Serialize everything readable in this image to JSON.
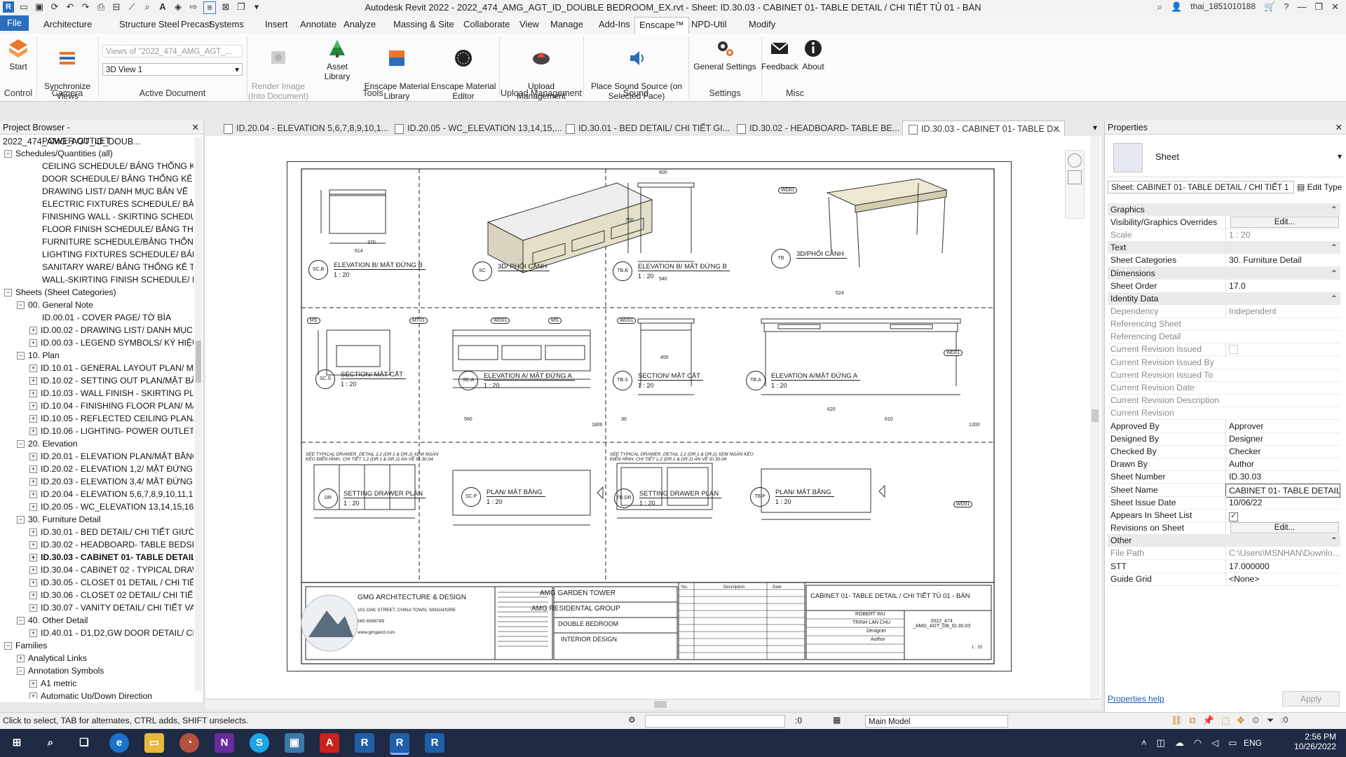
{
  "titlebar": {
    "title": "Autodesk Revit 2022 - 2022_474_AMG_AGT_ID_DOUBLE BEDROOM_EX.rvt - Sheet: ID.30.03 - CABINET 01- TABLE DETAIL / CHI TIẾT TỦ 01 - BÀN",
    "user": "thai_1851010188"
  },
  "menu": {
    "file": "File",
    "tabs": [
      "Architecture",
      "Structure",
      "Steel",
      "Precast",
      "Systems",
      "Insert",
      "Annotate",
      "Analyze",
      "Massing & Site",
      "Collaborate",
      "View",
      "Manage",
      "Add-Ins",
      "Enscape™",
      "NPD-Util",
      "Modify"
    ],
    "active": "Enscape™"
  },
  "ribbon": {
    "start": "Start",
    "sync": "Synchronize\nViews",
    "views_placeholder": "Views of \"2022_474_AMG_AGT_...",
    "view_combo": "3D View 1",
    "render": "Render Image\n(Into Document)",
    "asset": "Asset Library",
    "material_lib": "Enscape Material\nLibrary",
    "material_editor": "Enscape Material\nEditor",
    "upload": "Upload\nManagement",
    "sound": "Place Sound Source (on\nSelected Face)",
    "general": "General Settings",
    "feedback": "Feedback",
    "about": "About",
    "groups": [
      "Control",
      "Camera",
      "Active Document",
      "Tools",
      "Upload Management",
      "Sound",
      "Settings",
      "Misc"
    ]
  },
  "project_browser": {
    "title": "Project Browser - 2022_474_AMG_AGT_ID_DOUB...",
    "rows": [
      {
        "text": "POWER OUTLET",
        "indent": 3,
        "tog": ""
      },
      {
        "text": "Schedules/Quantities (all)",
        "indent": 0,
        "tog": "−"
      },
      {
        "text": "CEILING SCHEDULE/ BẢNG THỐNG KÊ TRẦ",
        "indent": 3,
        "tog": ""
      },
      {
        "text": "DOOR SCHEDULE/ BẢNG THỐNG KÊ CỬA",
        "indent": 3,
        "tog": ""
      },
      {
        "text": "DRAWING LIST/ DANH MỤC BẢN VẼ",
        "indent": 3,
        "tog": ""
      },
      {
        "text": "ELECTRIC FIXTURES SCHEDULE/ BẢNG THỐ",
        "indent": 3,
        "tog": ""
      },
      {
        "text": "FINISHING WALL - SKIRTING SCHEDULE",
        "indent": 3,
        "tog": ""
      },
      {
        "text": "FLOOR FINISH SCHEDULE/ BẢNG THỐNG K",
        "indent": 3,
        "tog": ""
      },
      {
        "text": "FURNITURE SCHEDULE/BẢNG THỐNG KÊ Đ",
        "indent": 3,
        "tog": ""
      },
      {
        "text": "LIGHTING FIXTURES SCHEDULE/ BẢNG THỐ",
        "indent": 3,
        "tog": ""
      },
      {
        "text": "SANITARY WARE/ BẢNG THỐNG KÊ TBVS",
        "indent": 3,
        "tog": ""
      },
      {
        "text": "WALL-SKIRTING FINISH SCHEDULE/ BẢNG T",
        "indent": 3,
        "tog": ""
      },
      {
        "text": "Sheets (Sheet Categories)",
        "indent": 0,
        "tog": "−"
      },
      {
        "text": "00. General Note",
        "indent": 1,
        "tog": "−"
      },
      {
        "text": "ID.00.01 - COVER PAGE/ TỜ BÌA",
        "indent": 3,
        "tog": ""
      },
      {
        "text": "ID.00.02 - DRAWING LIST/ DANH MỤC",
        "indent": 2,
        "tog": "+"
      },
      {
        "text": "ID.00.03 - LEGEND SYMBOLS/ KÝ HIỆU",
        "indent": 2,
        "tog": "+"
      },
      {
        "text": "10. Plan",
        "indent": 1,
        "tog": "−"
      },
      {
        "text": "ID.10.01 - GENERAL LAYOUT PLAN/ MẶ",
        "indent": 2,
        "tog": "+"
      },
      {
        "text": "ID.10.02 - SETTING OUT PLAN/MẶT BẰ",
        "indent": 2,
        "tog": "+"
      },
      {
        "text": "ID.10.03 - WALL FINISH - SKIRTING PLA",
        "indent": 2,
        "tog": "+"
      },
      {
        "text": "ID.10.04 - FINISHING FLOOR PLAN/ MẶ",
        "indent": 2,
        "tog": "+"
      },
      {
        "text": "ID.10.05 - REFLECTED CEILING PLAN/ M",
        "indent": 2,
        "tog": "+"
      },
      {
        "text": "ID.10.06 - LIGHTING- POWER OUTLET F",
        "indent": 2,
        "tog": "+"
      },
      {
        "text": "20. Elevation",
        "indent": 1,
        "tog": "−"
      },
      {
        "text": "ID.20.01 - ELEVATION PLAN/MẶT BẰNG",
        "indent": 2,
        "tog": "+"
      },
      {
        "text": "ID.20.02 - ELEVATION 1,2/ MẶT ĐỨNG",
        "indent": 2,
        "tog": "+"
      },
      {
        "text": "ID.20.03 - ELEVATION 3,4/ MẶT ĐỨNG",
        "indent": 2,
        "tog": "+"
      },
      {
        "text": "ID.20.04 - ELEVATION 5,6,7,8,9,10,11,1",
        "indent": 2,
        "tog": "+"
      },
      {
        "text": "ID.20.05 - WC_ELEVATION 13,14,15,16,",
        "indent": 2,
        "tog": "+"
      },
      {
        "text": "30. Furniture Detail",
        "indent": 1,
        "tog": "−"
      },
      {
        "text": "ID.30.01 - BED DETAIL/ CHI TIẾT GIƯỜN",
        "indent": 2,
        "tog": "+"
      },
      {
        "text": "ID.30.02 - HEADBOARD- TABLE BEDSID",
        "indent": 2,
        "tog": "+"
      },
      {
        "text": "ID.30.03 - CABINET 01- TABLE DETAIL",
        "indent": 2,
        "tog": "+",
        "bold": true
      },
      {
        "text": "ID.30.04 - CABINET 02 - TYPICAL DRAW",
        "indent": 2,
        "tog": "+"
      },
      {
        "text": "ID.30.05 - CLOSET 01 DETAIL / CHI TIẾT",
        "indent": 2,
        "tog": "+"
      },
      {
        "text": "ID.30.06 - CLOSET 02 DETAIL/ CHI TIẾT",
        "indent": 2,
        "tog": "+"
      },
      {
        "text": "ID.30.07 - VANITY DETAIL/ CHI TIẾT VAN",
        "indent": 2,
        "tog": "+"
      },
      {
        "text": "40. Other Detail",
        "indent": 1,
        "tog": "−"
      },
      {
        "text": "ID.40.01 - D1,D2,GW DOOR DETAIL/ CH",
        "indent": 2,
        "tog": "+"
      },
      {
        "text": "Families",
        "indent": 0,
        "tog": "−"
      },
      {
        "text": "Analytical Links",
        "indent": 1,
        "tog": "+"
      },
      {
        "text": "Annotation Symbols",
        "indent": 1,
        "tog": "−"
      },
      {
        "text": "A1 metric",
        "indent": 2,
        "tog": "+"
      },
      {
        "text": "Automatic Up/Down Direction",
        "indent": 2,
        "tog": "+"
      }
    ]
  },
  "view_tabs": [
    {
      "label": "ID.20.04 - ELEVATION 5,6,7,8,9,10,1...",
      "active": false
    },
    {
      "label": "ID.20.05 - WC_ELEVATION 13,14,15,...",
      "active": false
    },
    {
      "label": "ID.30.01 - BED DETAIL/ CHI TIẾT GI...",
      "active": false
    },
    {
      "label": "ID.30.02 - HEADBOARD- TABLE BE...",
      "active": false
    },
    {
      "label": "ID.30.03 - CABINET 01- TABLE D...",
      "active": true
    }
  ],
  "sheet": {
    "views": [
      {
        "tag": "SC.B",
        "title": "ELEVATION B/ MẶT ĐỨNG B",
        "scale": "1 : 20"
      },
      {
        "tag": "SC",
        "title": "3D/ PHỐI CẢNH",
        "scale": ""
      },
      {
        "tag": "TB.B",
        "title": "ELEVATION B/ MẶT ĐỨNG B",
        "scale": "1 : 20"
      },
      {
        "tag": "TB",
        "title": "3D/PHỐI CẢNH",
        "scale": ""
      },
      {
        "tag": "SC.S",
        "title": "SECTION/ MẶT CẮT",
        "scale": "1 : 20"
      },
      {
        "tag": "SC.A",
        "title": "ELEVATION A/ MẶT ĐỨNG A",
        "scale": "1 : 20"
      },
      {
        "tag": "TB.S",
        "title": "SECTION/ MẶT CẮT",
        "scale": "1 : 20"
      },
      {
        "tag": "TB.A",
        "title": "ELEVATION A/MẶT ĐỨNG A",
        "scale": "1 : 20"
      },
      {
        "tag": "DR",
        "title": "SETTING DRAWER PLAN",
        "scale": "1 : 20"
      },
      {
        "tag": "SC.P",
        "title": "PLAN/ MẶT BẰNG",
        "scale": "1 : 20"
      },
      {
        "tag": "TB.DR",
        "title": "SETTING DRAWER PLAN",
        "scale": "1 : 20"
      },
      {
        "tag": "TB.P",
        "title": "PLAN/ MẶT BẰNG",
        "scale": "1 : 20"
      }
    ],
    "notes": [
      "SEE TYPICAL DRAWER_DETAIL 1,2 (DR.1 & DR.2) XEM NGĂN KÉO ĐIỂN HÌNH, CHI TIẾT 1,2 (DR.1 & DR.2) ẢN VẼ ID.30.04",
      "SEE TYPICAL DRAWER_DETAIL 1,2 (DR.1 & DR.2) XEM NGĂN KÉO ĐIỂN HÌNH, CHI TIẾT 1,2 (DR.1 & DR.2) ẢN VẼ ID.30.04"
    ],
    "tags": [
      "WD01",
      "MS",
      "MT01",
      "WD01",
      "MS",
      "WD01",
      "WD01",
      "WD01"
    ],
    "dims": [
      "600",
      "614",
      "370",
      "560",
      "1800",
      "540",
      "610",
      "1200",
      "750",
      "450",
      "30",
      "524",
      "620"
    ],
    "titleblock": {
      "firm": "GMG ARCHITECTURE & DESIGN",
      "address": "101 OAK STREET, CHINA TOWN, SINGAPORE",
      "phone": "065 6586789",
      "web": "www.gmgand.com",
      "project": "AMG GARDEN TOWER",
      "client": "AMG RESIDENTAL GROUP",
      "room": "DOUBLE BEDROOM",
      "discipline": "INTERIOR DESIGN",
      "rev_headers": [
        "No.",
        "Description",
        "Date"
      ],
      "sheet_title": "CABINET 01- TABLE DETAIL / CHI TIẾT TỦ 01 - BÀN",
      "director": "ROBERT WU",
      "principal": "TRINH LAN CHU",
      "designed": "Designer",
      "drawn": "Author",
      "number": "2022_474\n_AMG_AGT_DB_ID.30.03",
      "scale": "1 : 20"
    }
  },
  "properties": {
    "title": "Properties",
    "type": "Sheet",
    "selector": "Sheet: CABINET 01- TABLE DETAIL / CHI TIẾT 1",
    "edit_type": "Edit Type",
    "groups": [
      {
        "name": "Graphics",
        "rows": [
          {
            "k": "Visibility/Graphics Overrides",
            "v": "Edit...",
            "btn": true
          },
          {
            "k": "Scale",
            "v": "1 : 20",
            "dim": true
          }
        ]
      },
      {
        "name": "Text",
        "rows": [
          {
            "k": "Sheet Categories",
            "v": "30. Furniture Detail"
          }
        ]
      },
      {
        "name": "Dimensions",
        "rows": [
          {
            "k": "Sheet Order",
            "v": "17.0"
          }
        ]
      },
      {
        "name": "Identity Data",
        "rows": [
          {
            "k": "Dependency",
            "v": "Independent",
            "dim": true
          },
          {
            "k": "Referencing Sheet",
            "v": "",
            "dim": true
          },
          {
            "k": "Referencing Detail",
            "v": "",
            "dim": true
          },
          {
            "k": "Current Revision Issued",
            "v": "",
            "dim": true,
            "check": false
          },
          {
            "k": "Current Revision Issued By",
            "v": "",
            "dim": true
          },
          {
            "k": "Current Revision Issued To",
            "v": "",
            "dim": true
          },
          {
            "k": "Current Revision Date",
            "v": "",
            "dim": true
          },
          {
            "k": "Current Revision Description",
            "v": "",
            "dim": true
          },
          {
            "k": "Current Revision",
            "v": "",
            "dim": true
          },
          {
            "k": "Approved By",
            "v": "Approver"
          },
          {
            "k": "Designed By",
            "v": "Designer"
          },
          {
            "k": "Checked By",
            "v": "Checker"
          },
          {
            "k": "Drawn By",
            "v": "Author"
          },
          {
            "k": "Sheet Number",
            "v": "ID.30.03"
          },
          {
            "k": "Sheet Name",
            "v": "CABINET 01- TABLE DETAIL",
            "boxed": true
          },
          {
            "k": "Sheet Issue Date",
            "v": "10/06/22"
          },
          {
            "k": "Appears In Sheet List",
            "v": "",
            "check": true
          },
          {
            "k": "Revisions on Sheet",
            "v": "Edit...",
            "btn": true
          }
        ]
      },
      {
        "name": "Other",
        "rows": [
          {
            "k": "File Path",
            "v": "C:\\Users\\MSNHAN\\Downlo...",
            "dim": true
          },
          {
            "k": "STT",
            "v": "17.000000"
          },
          {
            "k": "Guide Grid",
            "v": "<None>"
          }
        ]
      }
    ],
    "help": "Properties help",
    "apply": "Apply"
  },
  "status": {
    "hint": "Click to select, TAB for alternates, CTRL adds, SHIFT unselects.",
    "sel_count": ":0",
    "model": "Main Model",
    "filter_count": ":0"
  },
  "taskbar": {
    "lang": "ENG",
    "time": "2:56 PM",
    "date": "10/26/2022"
  },
  "colors": {
    "file_tab": "#2a6ebd",
    "taskbar": "#1f2a44",
    "accent": "#2a6ebd"
  }
}
